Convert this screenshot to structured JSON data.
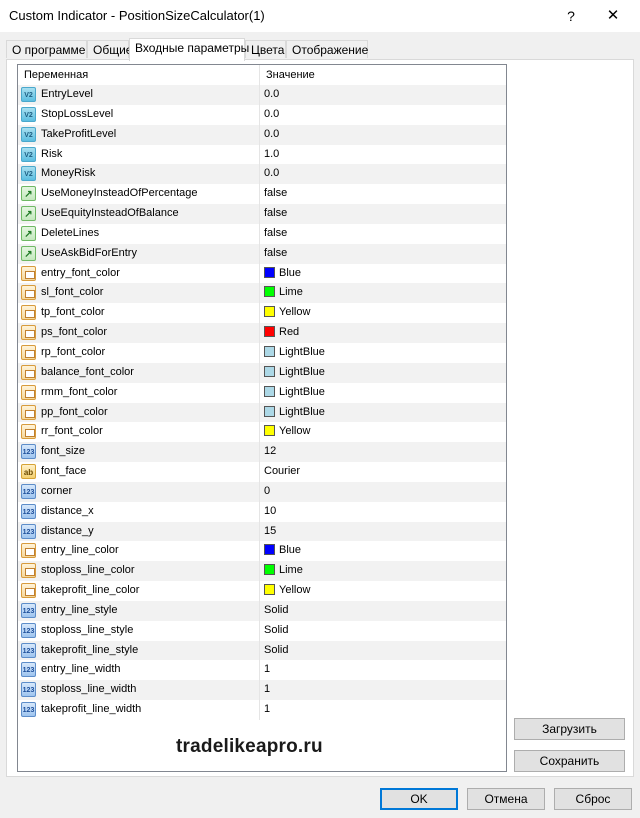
{
  "window": {
    "title": "Custom Indicator - PositionSizeCalculator(1)",
    "help": "?",
    "close": "✕"
  },
  "tabs": [
    {
      "label": "О программе"
    },
    {
      "label": "Общие"
    },
    {
      "label": "Входные параметры",
      "active": true
    },
    {
      "label": "Цвета"
    },
    {
      "label": "Отображение"
    }
  ],
  "grid": {
    "headers": {
      "variable": "Переменная",
      "value": "Значение"
    },
    "rows": [
      {
        "icon": "double-value-icon",
        "kind": "ve",
        "name": "EntryLevel",
        "value": "0.0"
      },
      {
        "icon": "double-value-icon",
        "kind": "ve",
        "name": "StopLossLevel",
        "value": "0.0"
      },
      {
        "icon": "double-value-icon",
        "kind": "ve",
        "name": "TakeProfitLevel",
        "value": "0.0"
      },
      {
        "icon": "double-value-icon",
        "kind": "ve",
        "name": "Risk",
        "value": "1.0"
      },
      {
        "icon": "double-value-icon",
        "kind": "ve",
        "name": "MoneyRisk",
        "value": "0.0"
      },
      {
        "icon": "boolean-icon",
        "kind": "bool",
        "name": "UseMoneyInsteadOfPercentage",
        "value": "false"
      },
      {
        "icon": "boolean-icon",
        "kind": "bool",
        "name": "UseEquityInsteadOfBalance",
        "value": "false"
      },
      {
        "icon": "boolean-icon",
        "kind": "bool",
        "name": "DeleteLines",
        "value": "false"
      },
      {
        "icon": "boolean-icon",
        "kind": "bool",
        "name": "UseAskBidForEntry",
        "value": "false"
      },
      {
        "icon": "color-icon",
        "kind": "col",
        "name": "entry_font_color",
        "value": "Blue",
        "color": "#0000ff"
      },
      {
        "icon": "color-icon",
        "kind": "col",
        "name": "sl_font_color",
        "value": "Lime",
        "color": "#00ff00"
      },
      {
        "icon": "color-icon",
        "kind": "col",
        "name": "tp_font_color",
        "value": "Yellow",
        "color": "#ffff00"
      },
      {
        "icon": "color-icon",
        "kind": "col",
        "name": "ps_font_color",
        "value": "Red",
        "color": "#ff0000"
      },
      {
        "icon": "color-icon",
        "kind": "col",
        "name": "rp_font_color",
        "value": "LightBlue",
        "color": "#add8e6"
      },
      {
        "icon": "color-icon",
        "kind": "col",
        "name": "balance_font_color",
        "value": "LightBlue",
        "color": "#add8e6"
      },
      {
        "icon": "color-icon",
        "kind": "col",
        "name": "rmm_font_color",
        "value": "LightBlue",
        "color": "#add8e6"
      },
      {
        "icon": "color-icon",
        "kind": "col",
        "name": "pp_font_color",
        "value": "LightBlue",
        "color": "#add8e6"
      },
      {
        "icon": "color-icon",
        "kind": "col",
        "name": "rr_font_color",
        "value": "Yellow",
        "color": "#ffff00"
      },
      {
        "icon": "integer-icon",
        "kind": "num",
        "name": "font_size",
        "value": "12"
      },
      {
        "icon": "string-icon",
        "kind": "str",
        "name": "font_face",
        "value": "Courier"
      },
      {
        "icon": "integer-icon",
        "kind": "num",
        "name": "corner",
        "value": "0"
      },
      {
        "icon": "integer-icon",
        "kind": "num",
        "name": "distance_x",
        "value": "10"
      },
      {
        "icon": "integer-icon",
        "kind": "num",
        "name": "distance_y",
        "value": "15"
      },
      {
        "icon": "color-icon",
        "kind": "col",
        "name": "entry_line_color",
        "value": "Blue",
        "color": "#0000ff"
      },
      {
        "icon": "color-icon",
        "kind": "col",
        "name": "stoploss_line_color",
        "value": "Lime",
        "color": "#00ff00"
      },
      {
        "icon": "color-icon",
        "kind": "col",
        "name": "takeprofit_line_color",
        "value": "Yellow",
        "color": "#ffff00"
      },
      {
        "icon": "integer-icon",
        "kind": "sty",
        "name": "entry_line_style",
        "value": "Solid"
      },
      {
        "icon": "integer-icon",
        "kind": "sty",
        "name": "stoploss_line_style",
        "value": "Solid"
      },
      {
        "icon": "integer-icon",
        "kind": "sty",
        "name": "takeprofit_line_style",
        "value": "Solid"
      },
      {
        "icon": "integer-icon",
        "kind": "num",
        "name": "entry_line_width",
        "value": "1"
      },
      {
        "icon": "integer-icon",
        "kind": "num",
        "name": "stoploss_line_width",
        "value": "1"
      },
      {
        "icon": "integer-icon",
        "kind": "num",
        "name": "takeprofit_line_width",
        "value": "1"
      }
    ]
  },
  "buttons": {
    "load": "Загрузить",
    "save": "Сохранить",
    "ok": "OK",
    "cancel": "Отмена",
    "reset": "Сброс"
  },
  "watermark": "tradelikeapro.ru"
}
